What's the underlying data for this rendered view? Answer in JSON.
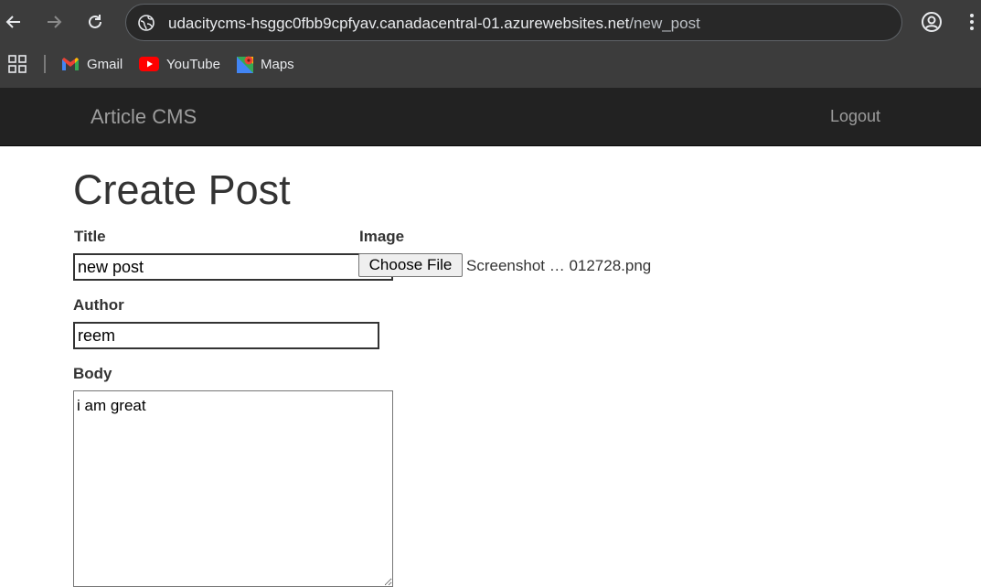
{
  "browser": {
    "url_host": "udacitycms-hsggc0fbb9cpfyav.canadacentral-01.azurewebsites.net",
    "url_path": "/new_post",
    "bookmarks": [
      {
        "label": "Gmail",
        "icon": "gmail-icon"
      },
      {
        "label": "YouTube",
        "icon": "youtube-icon"
      },
      {
        "label": "Maps",
        "icon": "maps-icon"
      }
    ]
  },
  "navbar": {
    "brand": "Article CMS",
    "logout": "Logout"
  },
  "form": {
    "page_title": "Create Post",
    "title_label": "Title",
    "title_value": "new post",
    "image_label": "Image",
    "choose_file_label": "Choose File",
    "file_name": "Screenshot … 012728.png",
    "author_label": "Author",
    "author_value": "reem",
    "body_label": "Body",
    "body_value": "i am great"
  },
  "colors": {
    "chrome_bg": "#3c3c3c",
    "omnibox_bg": "#282828",
    "navbar_bg": "#222222",
    "navbar_text": "#9d9d9d"
  }
}
